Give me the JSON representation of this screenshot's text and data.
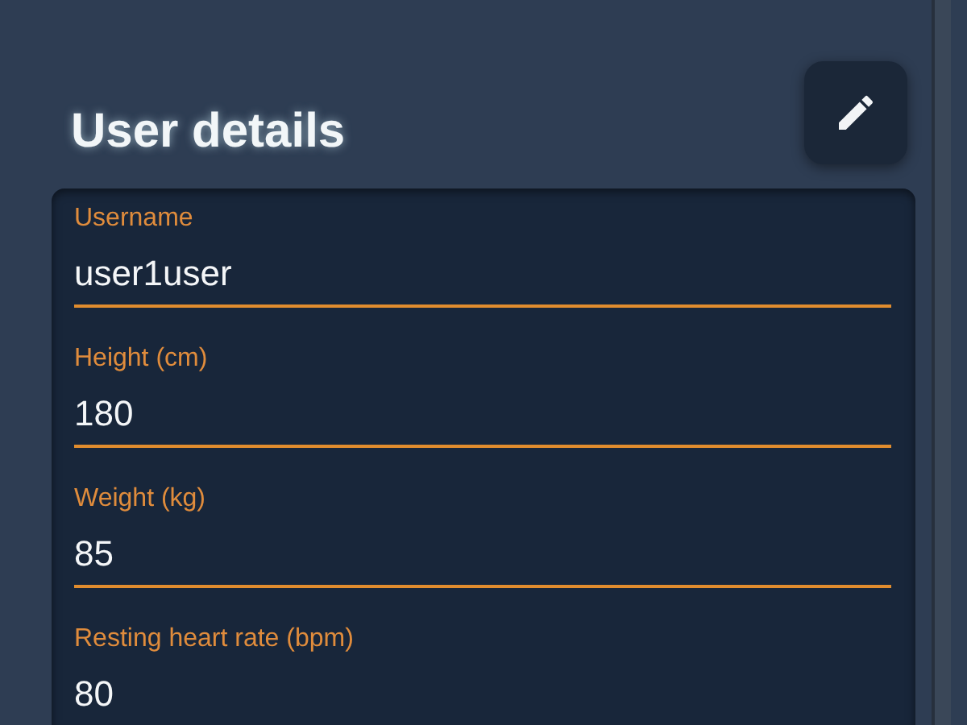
{
  "header": {
    "title": "User details"
  },
  "fields": [
    {
      "label": "Username",
      "value": "user1user"
    },
    {
      "label": "Height (cm)",
      "value": "180"
    },
    {
      "label": "Weight (kg)",
      "value": "85"
    },
    {
      "label": "Resting heart rate (bpm)",
      "value": "80"
    }
  ]
}
